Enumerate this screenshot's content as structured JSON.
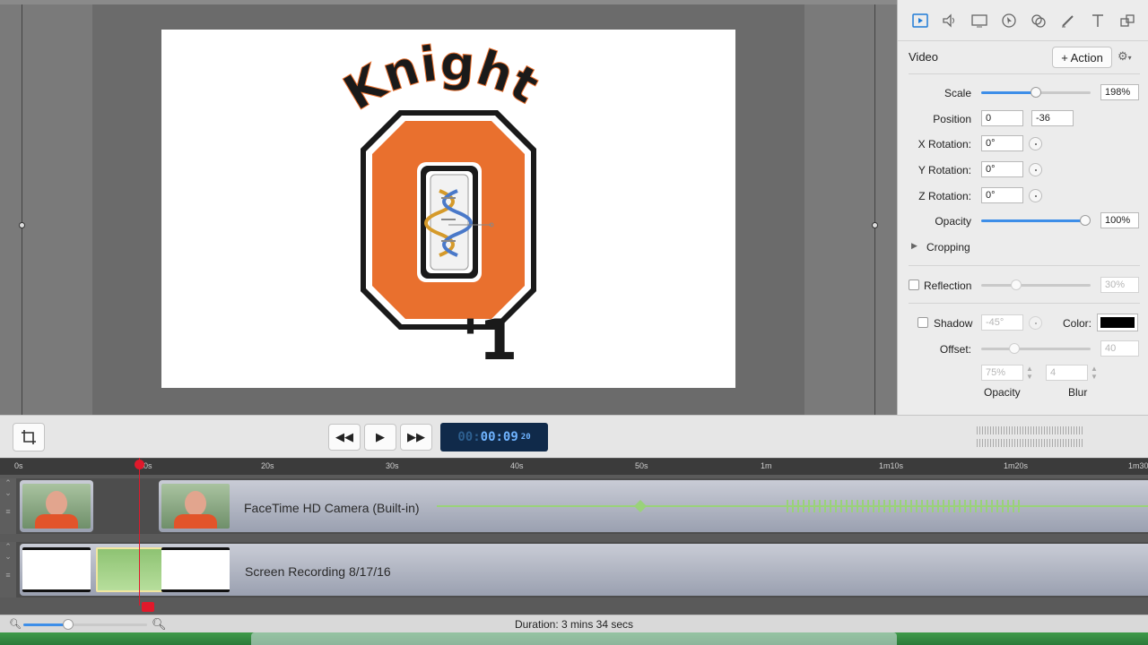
{
  "inspector": {
    "section_title": "Video",
    "action_label": "+ Action",
    "tabs": [
      "video-tab",
      "audio-tab",
      "screen-tab",
      "cursor-tab",
      "filters-tab",
      "annotations-tab",
      "text-tab",
      "layout-tab"
    ],
    "scale": {
      "label": "Scale",
      "value": "198%",
      "slider": 0.5
    },
    "position": {
      "label": "Position",
      "x": "0",
      "y": "-36"
    },
    "x_rotation": {
      "label": "X Rotation:",
      "value": "0°"
    },
    "y_rotation": {
      "label": "Y Rotation:",
      "value": "0°"
    },
    "z_rotation": {
      "label": "Z Rotation:",
      "value": "0°"
    },
    "opacity": {
      "label": "Opacity",
      "value": "100%",
      "slider": 1.0
    },
    "cropping_label": "Cropping",
    "reflection": {
      "label": "Reflection",
      "value": "30%",
      "slider": 0.3
    },
    "shadow": {
      "label": "Shadow",
      "angle": "-45°",
      "color_label": "Color:",
      "color": "#000000"
    },
    "offset": {
      "label": "Offset:",
      "value": "40",
      "slider": 0.3
    },
    "shadow_opacity": {
      "label": "Opacity",
      "value": "75%"
    },
    "blur": {
      "label": "Blur",
      "value": "4"
    }
  },
  "stage": {
    "logo_word": "Knight",
    "logo_letter": "O",
    "logo_number": "'1"
  },
  "transport": {
    "timecode_dim": "00:",
    "timecode_main": "00:09",
    "timecode_frames": "20"
  },
  "timeline": {
    "ruler": [
      {
        "label": "0s"
      },
      {
        "label": "10s"
      },
      {
        "label": "20s"
      },
      {
        "label": "30s"
      },
      {
        "label": "40s"
      },
      {
        "label": "50s"
      },
      {
        "label": "1m"
      },
      {
        "label": "1m10s"
      },
      {
        "label": "1m20s"
      },
      {
        "label": "1m30"
      }
    ],
    "tracks": [
      {
        "title": "FaceTime HD Camera (Built-in)"
      },
      {
        "title": "Screen Recording 8/17/16"
      }
    ]
  },
  "status": {
    "duration": "Duration: 3 mins 34 secs"
  },
  "colors": {
    "accent": "#3d8ee8",
    "playhead": "#e0192b",
    "logo_orange": "#e9702e",
    "timecode_bg": "#102a4a"
  }
}
